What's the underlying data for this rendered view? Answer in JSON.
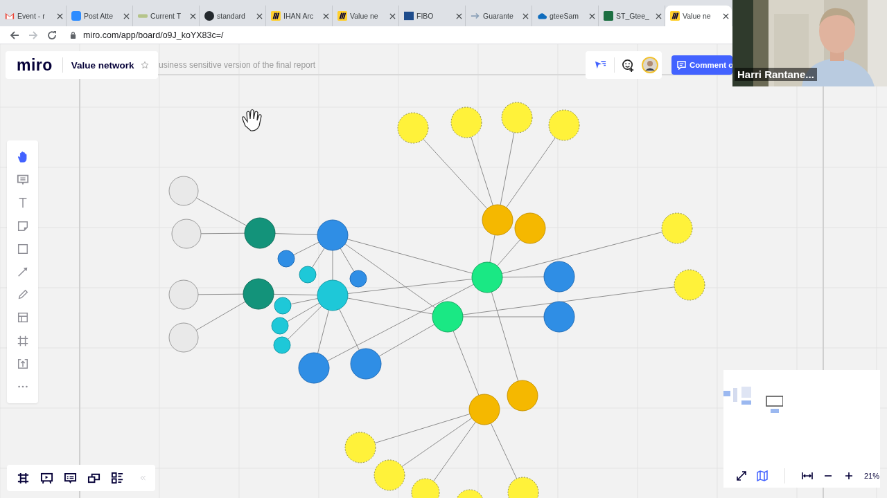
{
  "browser": {
    "tabs": [
      {
        "label": "Event - r",
        "selected": false
      },
      {
        "label": "Post Atte",
        "selected": false
      },
      {
        "label": "Current T",
        "selected": false
      },
      {
        "label": "standard",
        "selected": false
      },
      {
        "label": "IHAN Arc",
        "selected": false
      },
      {
        "label": "Value ne",
        "selected": false
      },
      {
        "label": "FIBO",
        "selected": false
      },
      {
        "label": "Guarante",
        "selected": false
      },
      {
        "label": "gteeSam",
        "selected": false
      },
      {
        "label": "ST_Gtee_",
        "selected": false
      },
      {
        "label": "Value ne",
        "selected": true
      }
    ],
    "url": "miro.com/app/board/o9J_koYX83c=/"
  },
  "board": {
    "logo": "miro",
    "title": "Value network",
    "description": "usiness sensitive version of the final report",
    "comment_button": "Comment o"
  },
  "tools": [
    {
      "kind": "hand",
      "selected": true
    },
    {
      "kind": "comment",
      "selected": false
    },
    {
      "kind": "text",
      "selected": false
    },
    {
      "kind": "sticky",
      "selected": false
    },
    {
      "kind": "shape",
      "selected": false
    },
    {
      "kind": "arrow",
      "selected": false
    },
    {
      "kind": "pen",
      "selected": false
    },
    {
      "kind": "template",
      "selected": false
    },
    {
      "kind": "frame",
      "selected": false
    },
    {
      "kind": "upload",
      "selected": false
    },
    {
      "kind": "more",
      "selected": false
    }
  ],
  "bottom_tools": [
    {
      "kind": "frames"
    },
    {
      "kind": "present"
    },
    {
      "kind": "comments"
    },
    {
      "kind": "screens"
    },
    {
      "kind": "cards"
    },
    {
      "kind": "collapse"
    }
  ],
  "zoom_level": "21%",
  "video": {
    "name": "Harri Rantane..."
  }
}
